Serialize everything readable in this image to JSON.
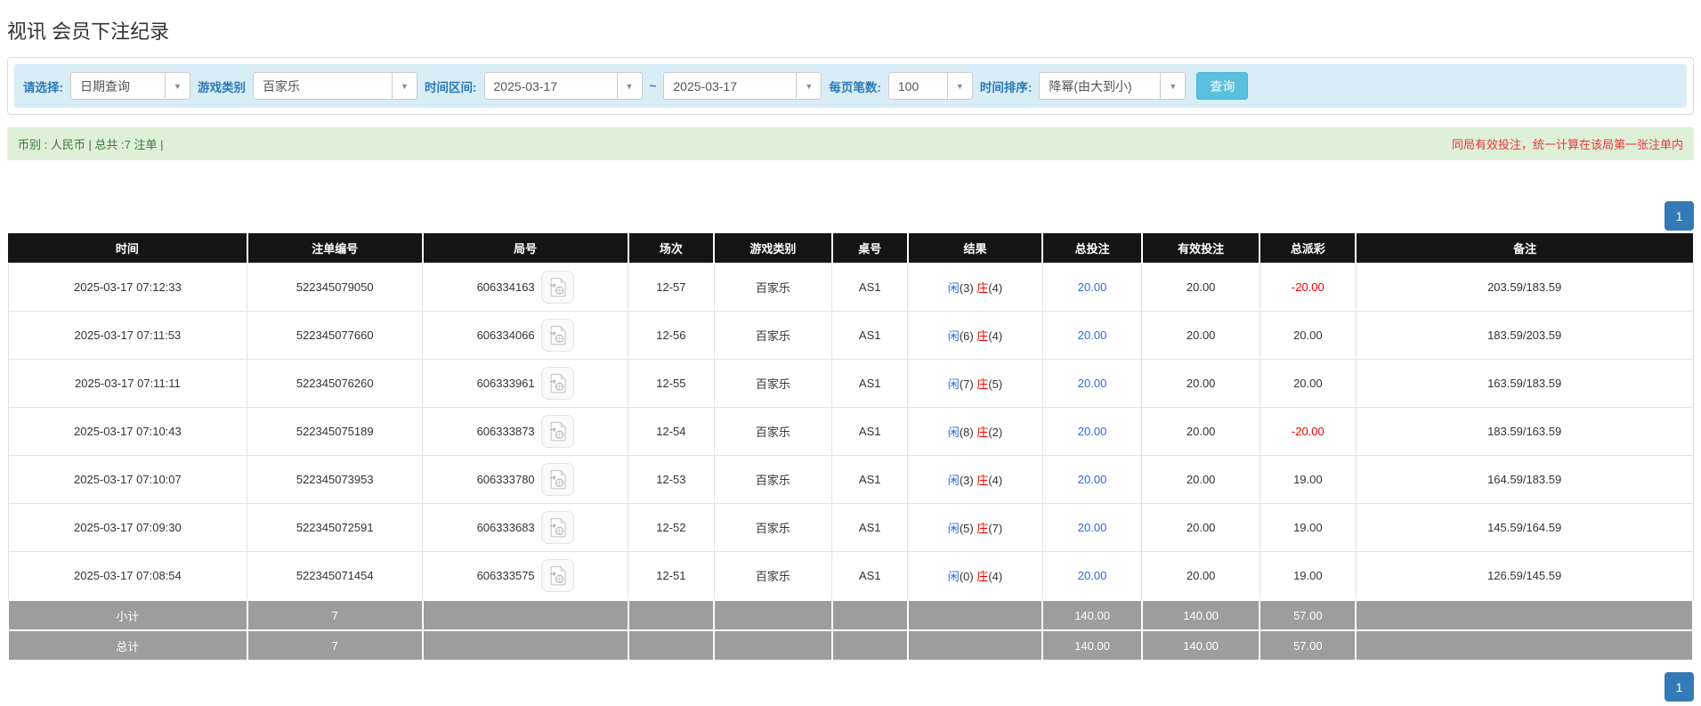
{
  "page": {
    "title": "视讯 会员下注纪录"
  },
  "colors": {
    "accent_blue": "#337ab7",
    "filter_bar_bg": "#d9edf7",
    "filter_label_blue": "#2c7ab8",
    "query_button_bg": "#5bc0de",
    "notice_bg": "#dff0d8",
    "notice_text_green": "#3c763d",
    "notice_warning_red": "#e4393c",
    "link_blue": "#2e66e8",
    "negative_red": "#f20000",
    "table_header_bg": "#151515",
    "summary_row_bg": "#9d9d9d"
  },
  "filters": {
    "select_label": "请选择:",
    "query_type": "日期查询",
    "game_type_label": "游戏类别",
    "game_type": "百家乐",
    "date_range_label": "时间区间:",
    "date_from": "2025-03-17",
    "date_separator": "~",
    "date_to": "2025-03-17",
    "page_size_label": "每页笔数:",
    "page_size": "100",
    "sort_label": "时间排序:",
    "sort_order": "降幂(由大到小)",
    "query_button": "查询"
  },
  "summary": {
    "left": "币别 : 人民币 | 总共 :7 注单 |",
    "right": "同局有效投注，统一计算在该局第一张注单内"
  },
  "pagination": {
    "page": "1"
  },
  "table": {
    "headers": [
      "时间",
      "注单编号",
      "局号",
      "场次",
      "游戏类别",
      "桌号",
      "结果",
      "总投注",
      "有效投注",
      "总派彩",
      "备注"
    ],
    "result_labels": {
      "player": "闲",
      "banker": "庄"
    },
    "rows": [
      {
        "time": "2025-03-17 07:12:33",
        "bet_id": "522345079050",
        "round_id": "606334163",
        "session": "12-57",
        "game": "百家乐",
        "table_no": "AS1",
        "player": "(3)",
        "banker": "(4)",
        "total_bet": "20.00",
        "valid_bet": "20.00",
        "payout": "-20.00",
        "remark": "203.59/183.59"
      },
      {
        "time": "2025-03-17 07:11:53",
        "bet_id": "522345077660",
        "round_id": "606334066",
        "session": "12-56",
        "game": "百家乐",
        "table_no": "AS1",
        "player": "(6)",
        "banker": "(4)",
        "total_bet": "20.00",
        "valid_bet": "20.00",
        "payout": "20.00",
        "remark": "183.59/203.59"
      },
      {
        "time": "2025-03-17 07:11:11",
        "bet_id": "522345076260",
        "round_id": "606333961",
        "session": "12-55",
        "game": "百家乐",
        "table_no": "AS1",
        "player": "(7)",
        "banker": "(5)",
        "total_bet": "20.00",
        "valid_bet": "20.00",
        "payout": "20.00",
        "remark": "163.59/183.59"
      },
      {
        "time": "2025-03-17 07:10:43",
        "bet_id": "522345075189",
        "round_id": "606333873",
        "session": "12-54",
        "game": "百家乐",
        "table_no": "AS1",
        "player": "(8)",
        "banker": "(2)",
        "total_bet": "20.00",
        "valid_bet": "20.00",
        "payout": "-20.00",
        "remark": "183.59/163.59"
      },
      {
        "time": "2025-03-17 07:10:07",
        "bet_id": "522345073953",
        "round_id": "606333780",
        "session": "12-53",
        "game": "百家乐",
        "table_no": "AS1",
        "player": "(3)",
        "banker": "(4)",
        "total_bet": "20.00",
        "valid_bet": "20.00",
        "payout": "19.00",
        "remark": "164.59/183.59"
      },
      {
        "time": "2025-03-17 07:09:30",
        "bet_id": "522345072591",
        "round_id": "606333683",
        "session": "12-52",
        "game": "百家乐",
        "table_no": "AS1",
        "player": "(5)",
        "banker": "(7)",
        "total_bet": "20.00",
        "valid_bet": "20.00",
        "payout": "19.00",
        "remark": "145.59/164.59"
      },
      {
        "time": "2025-03-17 07:08:54",
        "bet_id": "522345071454",
        "round_id": "606333575",
        "session": "12-51",
        "game": "百家乐",
        "table_no": "AS1",
        "player": "(0)",
        "banker": "(4)",
        "total_bet": "20.00",
        "valid_bet": "20.00",
        "payout": "19.00",
        "remark": "126.59/145.59"
      }
    ],
    "footer": [
      {
        "label": "小计",
        "bet_count": "7",
        "total_bet": "140.00",
        "valid_bet": "140.00",
        "payout": "57.00"
      },
      {
        "label": "总计",
        "bet_count": "7",
        "total_bet": "140.00",
        "valid_bet": "140.00",
        "payout": "57.00"
      }
    ]
  }
}
